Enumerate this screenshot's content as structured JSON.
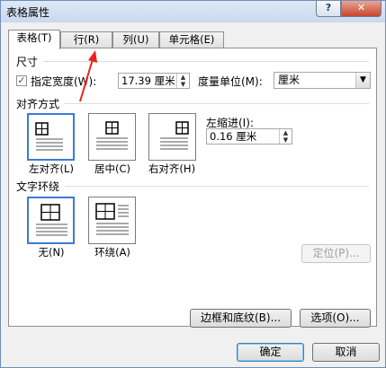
{
  "window": {
    "title": "表格属性",
    "help": "?",
    "close": "✕"
  },
  "tabs": [
    {
      "label": "表格(T)"
    },
    {
      "label": "行(R)"
    },
    {
      "label": "列(U)"
    },
    {
      "label": "单元格(E)"
    }
  ],
  "size": {
    "section": "尺寸",
    "preferred_width_label": "指定宽度(W):",
    "preferred_width_checked": true,
    "width_value": "17.39 厘米",
    "measure_label": "度量单位(M):",
    "measure_value": "厘米"
  },
  "alignment": {
    "section": "对齐方式",
    "options": [
      {
        "label": "左对齐(L)",
        "icon": "align-left-table-icon",
        "selected": true
      },
      {
        "label": "居中(C)",
        "icon": "align-center-table-icon",
        "selected": false
      },
      {
        "label": "右对齐(H)",
        "icon": "align-right-table-icon",
        "selected": false
      }
    ],
    "indent_label": "左缩进(I):",
    "indent_value": "0.16 厘米"
  },
  "wrapping": {
    "section": "文字环绕",
    "options": [
      {
        "label": "无(N)",
        "icon": "wrap-none-icon",
        "selected": true
      },
      {
        "label": "环绕(A)",
        "icon": "wrap-around-icon",
        "selected": false
      }
    ],
    "position_button": "定位(P)..."
  },
  "buttons": {
    "borders": "边框和底纹(B)...",
    "options": "选项(O)...",
    "ok": "确定",
    "cancel": "取消"
  },
  "colors": {
    "annotation_arrow": "#e8231b",
    "selection": "#3a7bd5"
  }
}
